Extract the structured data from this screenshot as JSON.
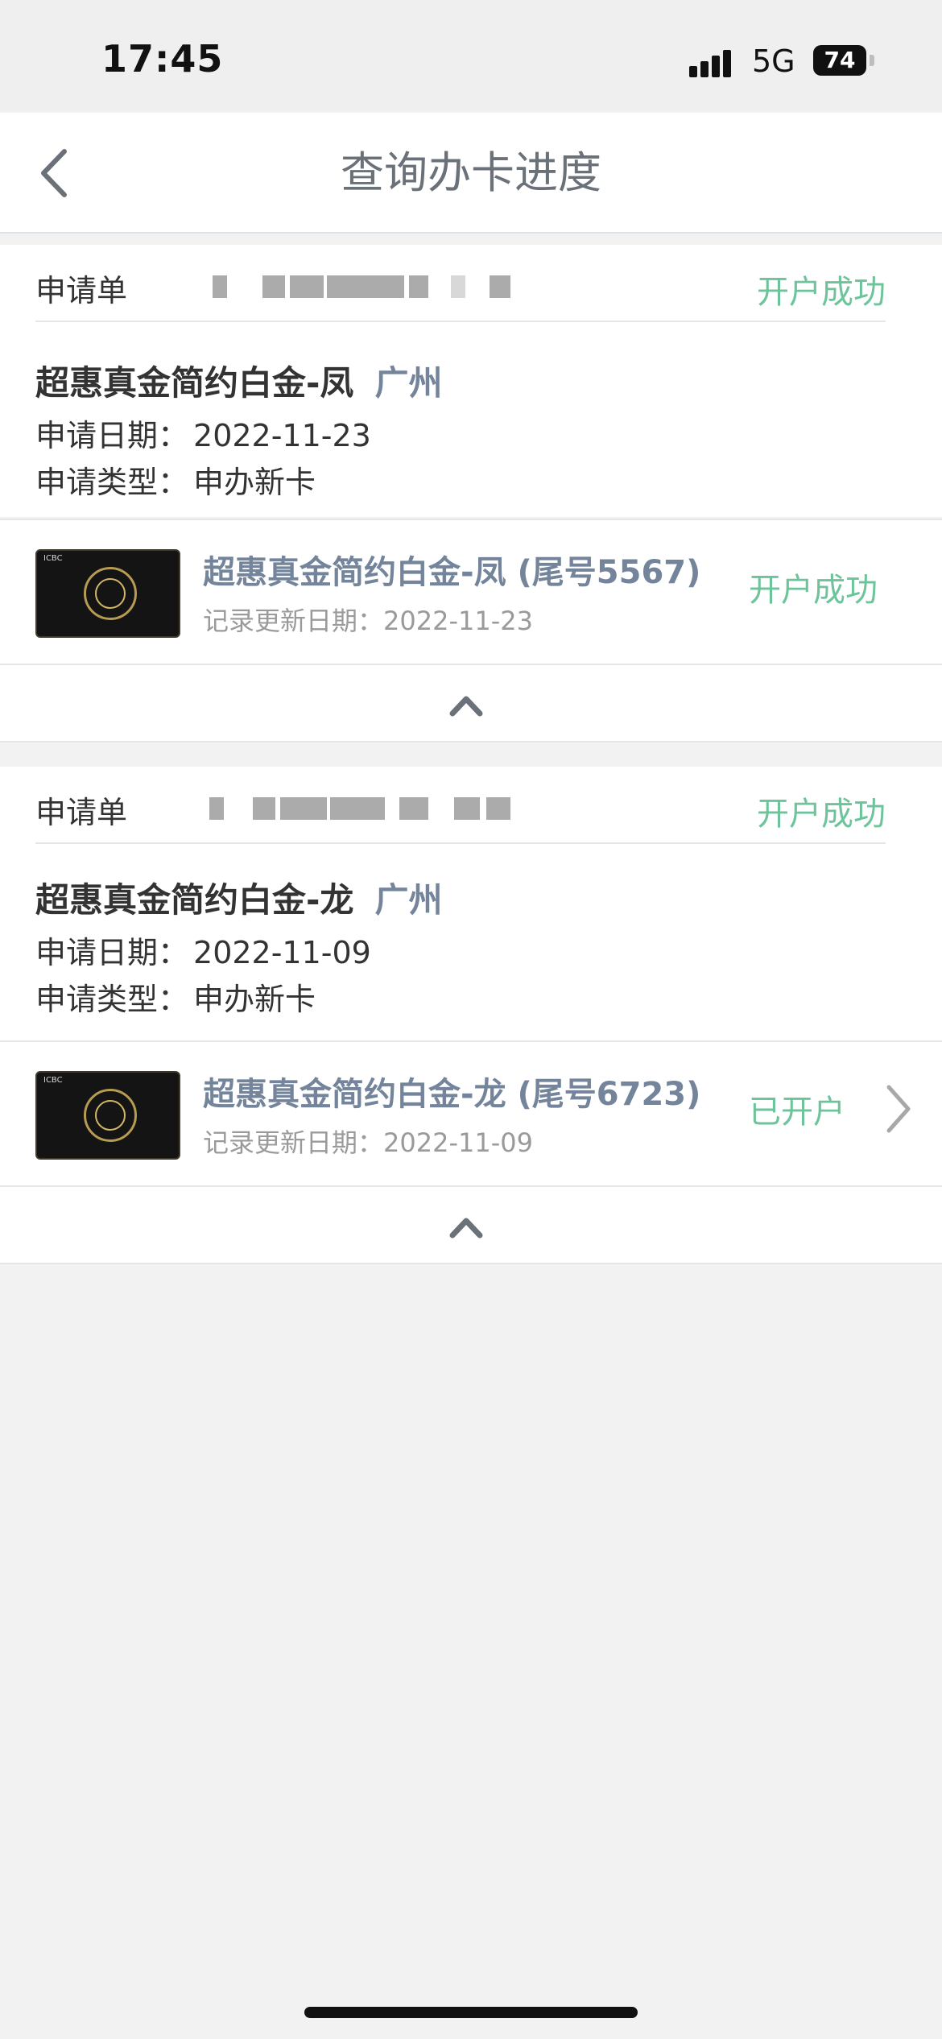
{
  "status_bar": {
    "time": "17:45",
    "network": "5G",
    "battery": "74",
    "icons": [
      "signal-icon",
      "battery-icon"
    ]
  },
  "nav": {
    "title": "查询办卡进度",
    "back_icon": "chevron-left-icon"
  },
  "applications": [
    {
      "app_no_label": "申请单",
      "status": "开户成功",
      "product": "超惠真金简约白金-凤",
      "city": "广州",
      "date_label": "申请日期：",
      "date": "2022-11-23",
      "type_label": "申请类型：",
      "type": "申办新卡",
      "card": {
        "name": "超惠真金简约白金-凤 (尾号5567)",
        "update_label": "记录更新日期：",
        "update_date": "2022-11-23",
        "status": "开户成功",
        "card_brand": "ICBC"
      },
      "collapse_icon": "chevron-up-icon"
    },
    {
      "app_no_label": "申请单",
      "status": "开户成功",
      "product": "超惠真金简约白金-龙",
      "city": "广州",
      "date_label": "申请日期：",
      "date": "2022-11-09",
      "type_label": "申请类型：",
      "type": "申办新卡",
      "card": {
        "name": "超惠真金简约白金-龙 (尾号6723)",
        "update_label": "记录更新日期：",
        "update_date": "2022-11-09",
        "status": "已开户",
        "card_brand": "ICBC",
        "arrow_icon": "chevron-right-icon"
      },
      "collapse_icon": "chevron-up-icon"
    }
  ],
  "colors": {
    "background": "#f2f2f2",
    "success": "#6dc49b",
    "accent": "#73849b",
    "text": "#333333"
  }
}
